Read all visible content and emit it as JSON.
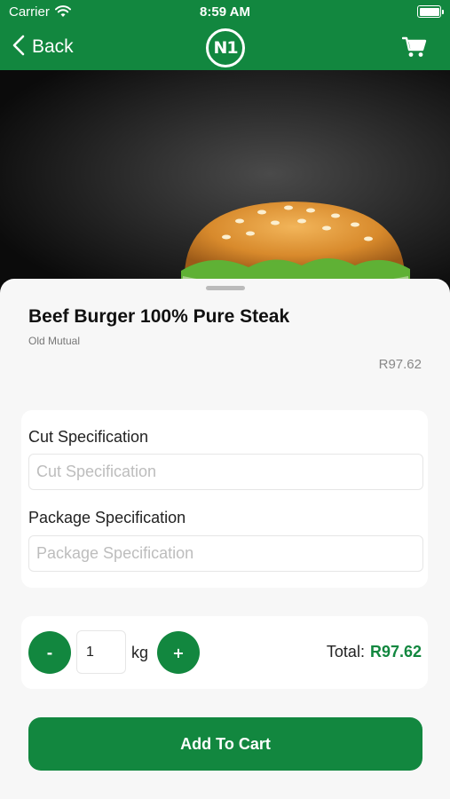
{
  "status_bar": {
    "carrier": "Carrier",
    "time": "8:59 AM",
    "icons": [
      "wifi-icon",
      "battery-icon"
    ]
  },
  "nav": {
    "back_label": "Back",
    "logo_text": "N1",
    "cart_icon": "cart-icon",
    "back_icon": "chevron-left-icon"
  },
  "product": {
    "title": "Beef Burger 100% Pure Steak",
    "subtitle": "Old Mutual",
    "price": "R97.62"
  },
  "specs": {
    "cut_label": "Cut Specification",
    "cut_placeholder": "Cut Specification",
    "cut_value": "",
    "package_label": "Package Specification",
    "package_placeholder": "Package Specification",
    "package_value": ""
  },
  "quantity": {
    "minus_label": "-",
    "value": "1",
    "unit": "kg",
    "plus_label": "+"
  },
  "total": {
    "label": "Total:",
    "value": "R97.62"
  },
  "add_to_cart_label": "Add To Cart",
  "colors": {
    "primary": "#12873f",
    "background": "#f7f7f7",
    "card": "#ffffff",
    "muted_text": "#888888"
  }
}
